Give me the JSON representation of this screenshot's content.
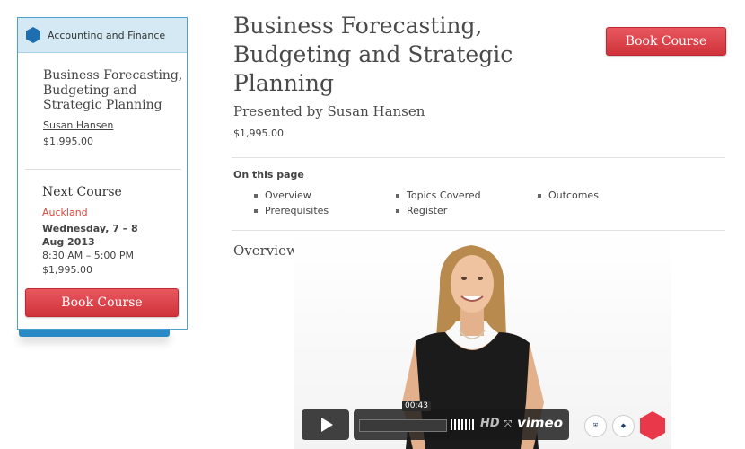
{
  "sidebar": {
    "category": "Accounting and Finance",
    "course_title": "Business Forecasting, Budgeting and Strategic Planning",
    "presenter": "Susan Hansen",
    "price": "$1,995.00",
    "next_course_heading": "Next Course",
    "next_city": "Auckland",
    "next_date": "Wednesday, 7 – 8 Aug 2013",
    "next_time": "8:30 AM – 5:00 PM",
    "next_price": "$1,995.00",
    "book_label": "Book Course"
  },
  "main": {
    "title": "Business Forecasting, Budgeting and Strategic Planning",
    "book_label": "Book Course",
    "presented_by": "Presented by Susan Hansen",
    "price": "$1,995.00",
    "on_this_page_heading": "On this page",
    "on_this_page_links": [
      "Overview",
      "Topics Covered",
      "Outcomes",
      "Prerequisites",
      "Register"
    ],
    "overview_heading": "Overview"
  },
  "video": {
    "time": "00:43",
    "progress": 0.0,
    "hd_label": "HD",
    "fullscreen_glyph": "⤧",
    "brand": "vimeo"
  },
  "colors": {
    "accent_blue": "#1e6faf",
    "book_red": "#d9383f",
    "city_red": "#d9483b"
  }
}
